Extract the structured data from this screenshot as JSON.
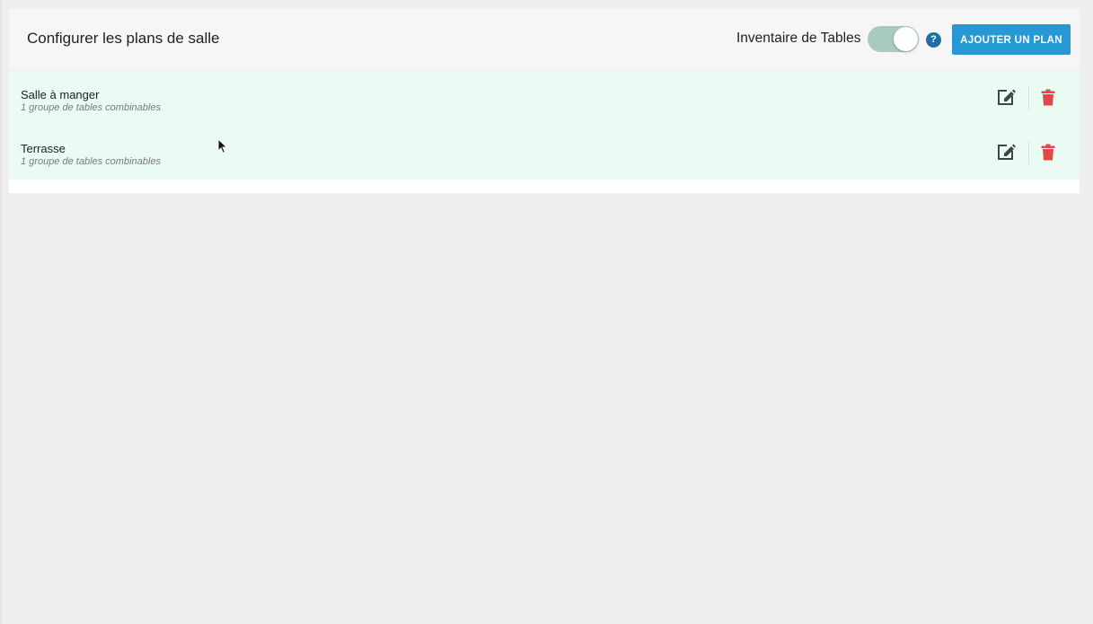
{
  "header": {
    "title": "Configurer les plans de salle",
    "inventory_label": "Inventaire de Tables",
    "inventory_toggle_on": true,
    "help_symbol": "?",
    "add_button_label": "AJOUTER UN PLAN"
  },
  "plans": [
    {
      "name": "Salle à manger",
      "subtitle": "1 groupe de tables combinables"
    },
    {
      "name": "Terrasse",
      "subtitle": "1 groupe de tables combinables"
    }
  ],
  "icons": {
    "edit": "pencil-square-icon",
    "delete": "trash-icon",
    "help": "question-circle-icon"
  },
  "colors": {
    "accent": "#2698d3",
    "toggle_on": "#a9cbbd",
    "list_background": "#e9fbf3",
    "delete": "#e04848",
    "help": "#1f6fa6"
  }
}
